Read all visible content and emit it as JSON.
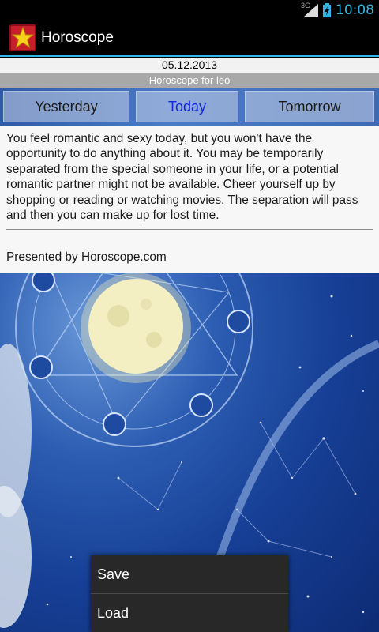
{
  "status_bar": {
    "network": "3G",
    "time": "10:08"
  },
  "app": {
    "title": "Horoscope",
    "icon": "star-icon"
  },
  "header": {
    "date": "05.12.2013",
    "sign_line": "Horoscope for leo"
  },
  "tabs": [
    {
      "label": "Yesterday",
      "selected": false
    },
    {
      "label": "Today",
      "selected": true
    },
    {
      "label": "Tomorrow",
      "selected": false
    }
  ],
  "content": {
    "text": "You feel romantic and sexy today, but you won't have the opportunity to do anything about it. You may be temporarily separated from the special someone in your life, or a potential romantic partner might not be available. Cheer yourself up by shopping or reading or watching movies. The separation will pass and then you can make up for lost time.",
    "presented_by": "Presented by Horoscope.com"
  },
  "menu": {
    "items": [
      "Save",
      "Load"
    ]
  },
  "colors": {
    "accent": "#33b5e5",
    "today_tab": "#1226e0",
    "menu_bg": "#282828"
  }
}
